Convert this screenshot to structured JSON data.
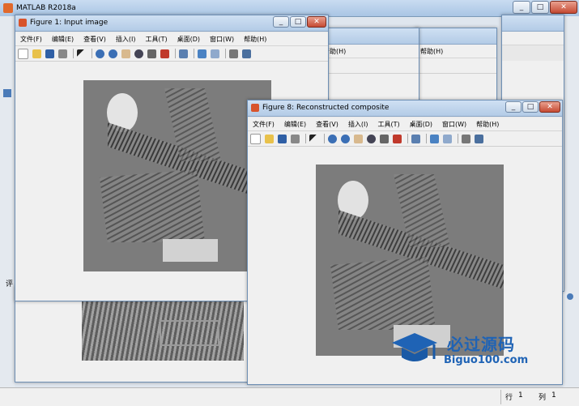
{
  "main": {
    "title": "MATLAB R2018a"
  },
  "figures": {
    "input": {
      "title": "Figure 1: Input image"
    },
    "recon": {
      "title": "Figure 8: Reconstructed composite"
    },
    "bg_a": {
      "menu_tail": "帮助(H)"
    },
    "bg_b": {
      "menu_tail": "帮助(H)"
    }
  },
  "menu": [
    "文件(F)",
    "编辑(E)",
    "查看(V)",
    "插入(I)",
    "工具(T)",
    "桌面(D)",
    "窗口(W)",
    "帮助(H)"
  ],
  "status": {
    "row_label": "行",
    "row_value": "1",
    "col_label": "列",
    "col_value": "1"
  },
  "watermark": {
    "title": "必过源码",
    "url": "Biguo100.com"
  },
  "left_edge_char": "评",
  "colors": {
    "titlebar": "#b3cbe6",
    "figure_bg": "#f0f0f0",
    "image_gray": "#7f7f7f"
  }
}
